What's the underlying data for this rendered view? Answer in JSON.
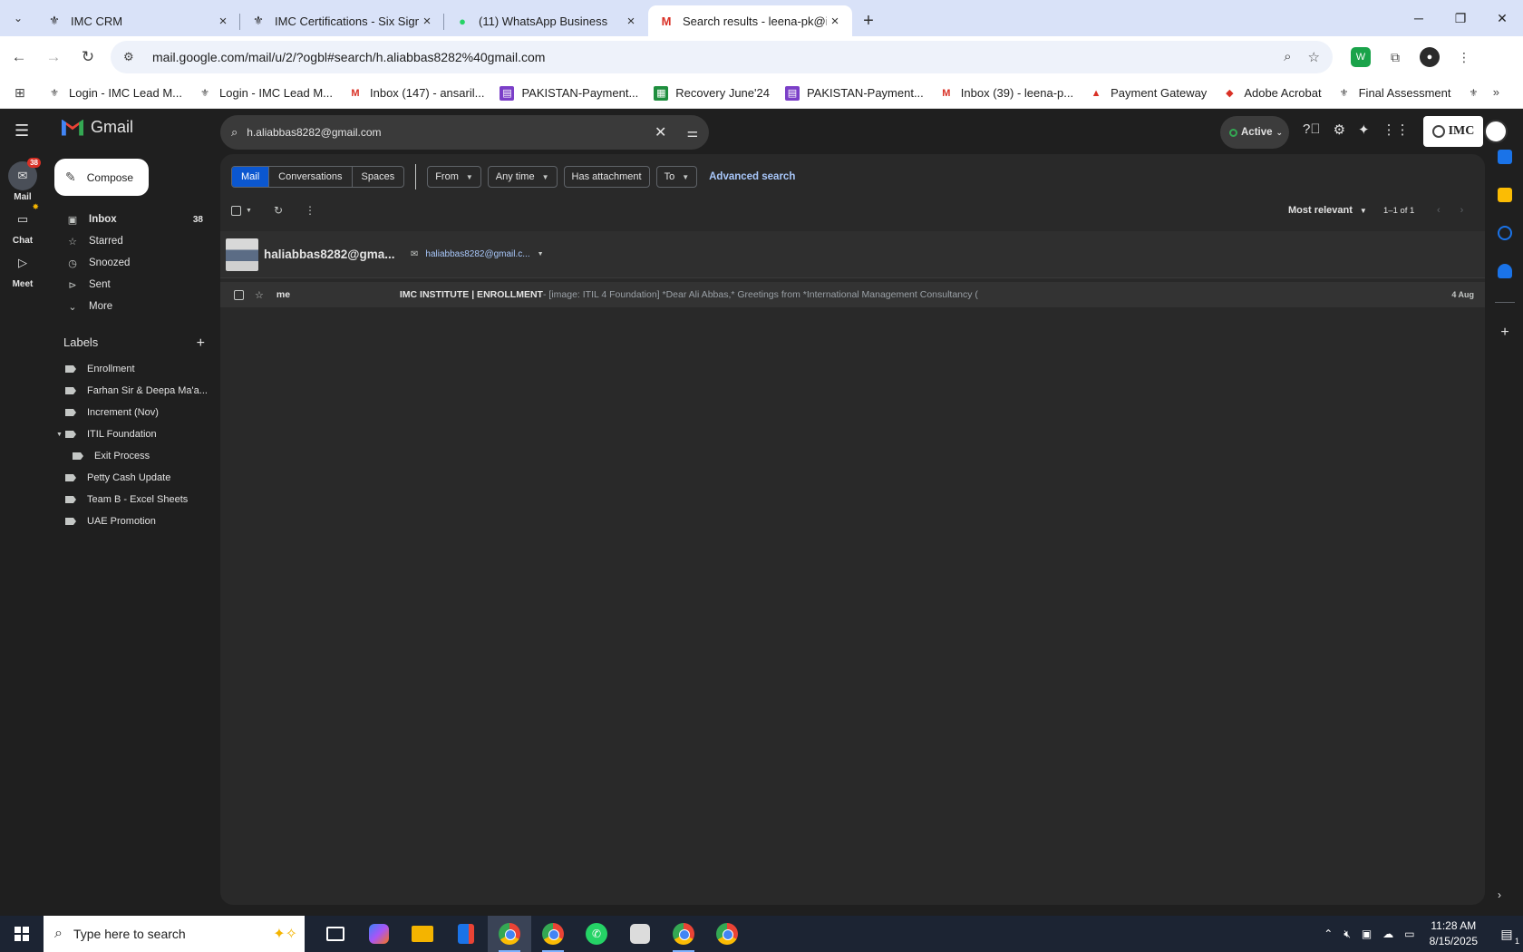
{
  "browser": {
    "tabs": [
      {
        "title": "IMC CRM",
        "favicon": "imc-icon",
        "active": false
      },
      {
        "title": "IMC Certifications - Six Sigma G",
        "favicon": "imc-icon",
        "active": false
      },
      {
        "title": "(11) WhatsApp Business",
        "favicon": "whatsapp-icon",
        "active": false
      },
      {
        "title": "Search results - leena-pk@imcc",
        "favicon": "gmail-icon",
        "active": true
      }
    ],
    "url": "mail.google.com/mail/u/2/?ogbl#search/h.aliabbas8282%40gmail.com",
    "bookmarks": [
      {
        "label": "Login - IMC Lead M...",
        "icon": "imc"
      },
      {
        "label": "Login - IMC Lead M...",
        "icon": "imc"
      },
      {
        "label": "Inbox (147) - ansaril...",
        "icon": "gmail"
      },
      {
        "label": "PAKISTAN-Payment...",
        "icon": "sheet"
      },
      {
        "label": "Recovery June'24",
        "icon": "gsheet"
      },
      {
        "label": "PAKISTAN-Payment...",
        "icon": "sheet"
      },
      {
        "label": "Inbox (39) - leena-p...",
        "icon": "gmail"
      },
      {
        "label": "Payment Gateway",
        "icon": "pdf"
      },
      {
        "label": "Adobe Acrobat",
        "icon": "pdf"
      },
      {
        "label": "Final Assessment",
        "icon": "imc"
      }
    ]
  },
  "gmail": {
    "brand": "Gmail",
    "rail": [
      {
        "label": "Mail",
        "badge": "38"
      },
      {
        "label": "Chat"
      },
      {
        "label": "Meet"
      }
    ],
    "compose_label": "Compose",
    "nav": [
      {
        "label": "Inbox",
        "count": "38"
      },
      {
        "label": "Starred",
        "count": ""
      },
      {
        "label": "Snoozed",
        "count": ""
      },
      {
        "label": "Sent",
        "count": ""
      },
      {
        "label": "More",
        "count": ""
      }
    ],
    "labels_title": "Labels",
    "labels": [
      {
        "name": "Enrollment"
      },
      {
        "name": "Farhan Sir & Deepa Ma'a..."
      },
      {
        "name": "Increment (Nov)"
      },
      {
        "name": "ITIL Foundation"
      },
      {
        "name": "Exit Process"
      },
      {
        "name": "Petty Cash Update"
      },
      {
        "name": "Team B - Excel Sheets"
      },
      {
        "name": "UAE Promotion"
      }
    ],
    "search": {
      "value": "h.aliabbas8282@gmail.com"
    },
    "status": "Active",
    "org_logo_text": "IMC",
    "filters": {
      "segments": [
        "Mail",
        "Conversations",
        "Spaces"
      ],
      "chips": [
        "From",
        "Any time",
        "Has attachment",
        "To"
      ],
      "advanced": "Advanced search"
    },
    "list": {
      "sort": "Most relevant",
      "range": "1–1 of 1"
    },
    "contact": {
      "name": "haliabbas8282@gma...",
      "email": "haliabbas8282@gmail.c..."
    },
    "messages": [
      {
        "sender": "me",
        "subject": "IMC INSTITUTE | ENROLLMENT",
        "snippet": " - [image: ITIL 4 Foundation] *Dear Ali Abbas,* Greetings from *International Management Consultancy (",
        "date": "4 Aug"
      }
    ]
  },
  "taskbar": {
    "search_placeholder": "Type here to search",
    "time": "11:28 AM",
    "date": "8/15/2025",
    "notifications": "1"
  }
}
